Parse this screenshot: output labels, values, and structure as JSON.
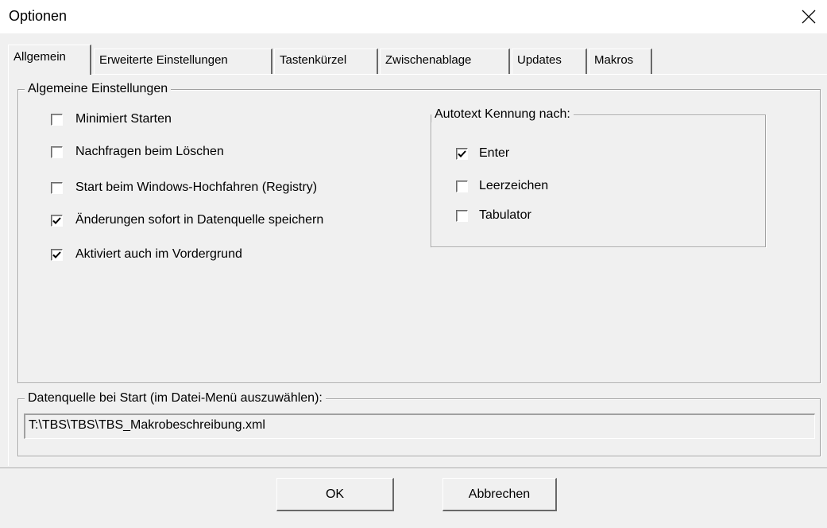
{
  "window": {
    "title": "Optionen"
  },
  "tabs": [
    {
      "label": "Allgemein",
      "active": true
    },
    {
      "label": "Erweiterte Einstellungen",
      "active": false
    },
    {
      "label": "Tastenkürzel",
      "active": false
    },
    {
      "label": "Zwischenablage",
      "active": false
    },
    {
      "label": "Updates",
      "active": false
    },
    {
      "label": "Makros",
      "active": false
    }
  ],
  "general": {
    "group_title": "Algemeine Einstellungen",
    "options": [
      {
        "label": "Minimiert Starten",
        "checked": false
      },
      {
        "label": "Nachfragen beim Löschen",
        "checked": false
      },
      {
        "label": "Start beim Windows-Hochfahren (Registry)",
        "checked": false
      },
      {
        "label": "Änderungen sofort in Datenquelle speichern",
        "checked": true
      },
      {
        "label": "Aktiviert auch im Vordergrund",
        "checked": true
      }
    ]
  },
  "autotext": {
    "group_title": "Autotext Kennung nach:",
    "options": [
      {
        "label": "Enter",
        "checked": true
      },
      {
        "label": "Leerzeichen",
        "checked": false
      },
      {
        "label": "Tabulator",
        "checked": false
      }
    ]
  },
  "datasource": {
    "group_title": "Datenquelle bei Start (im Datei-Menü auszuwählen):",
    "path": "T:\\TBS\\TBS\\TBS_Makrobeschreibung.xml"
  },
  "buttons": {
    "ok": "OK",
    "cancel": "Abbrechen"
  },
  "icons": {
    "close": "close-icon",
    "check": "checkmark-icon"
  }
}
